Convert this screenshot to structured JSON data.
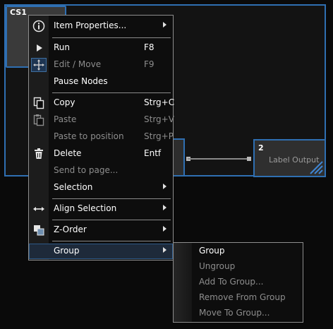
{
  "canvas": {
    "node_cs1_id": "CS1",
    "node_label_output_id": "2",
    "node_label_output_title": "Label Output"
  },
  "context_menu": {
    "items": [
      {
        "label": "Item Properties...",
        "shortcut": "",
        "icon": "info-icon",
        "submenu": true,
        "enabled": true
      },
      {
        "label": "Run",
        "shortcut": "F8",
        "icon": "play-icon",
        "submenu": false,
        "enabled": true
      },
      {
        "label": "Edit / Move",
        "shortcut": "F9",
        "icon": "move-icon",
        "submenu": false,
        "enabled": false
      },
      {
        "label": "Pause Nodes",
        "shortcut": "",
        "icon": "",
        "submenu": false,
        "enabled": true
      },
      {
        "label": "Copy",
        "shortcut": "Strg+C",
        "icon": "copy-icon",
        "submenu": false,
        "enabled": true
      },
      {
        "label": "Paste",
        "shortcut": "Strg+V",
        "icon": "paste-icon",
        "submenu": false,
        "enabled": false
      },
      {
        "label": "Paste to position",
        "shortcut": "Strg+P",
        "icon": "",
        "submenu": false,
        "enabled": false
      },
      {
        "label": "Delete",
        "shortcut": "Entf",
        "icon": "trash-icon",
        "submenu": false,
        "enabled": true
      },
      {
        "label": "Send to page...",
        "shortcut": "",
        "icon": "",
        "submenu": false,
        "enabled": false
      },
      {
        "label": "Selection",
        "shortcut": "",
        "icon": "",
        "submenu": true,
        "enabled": true
      },
      {
        "label": "Align Selection",
        "shortcut": "",
        "icon": "align-horizontal-icon",
        "submenu": true,
        "enabled": true
      },
      {
        "label": "Z-Order",
        "shortcut": "",
        "icon": "z-order-icon",
        "submenu": true,
        "enabled": true
      },
      {
        "label": "Group",
        "shortcut": "",
        "icon": "",
        "submenu": true,
        "enabled": true,
        "highlighted": true
      }
    ]
  },
  "group_submenu": {
    "items": [
      {
        "label": "Group",
        "enabled": true
      },
      {
        "label": "Ungroup",
        "enabled": false
      },
      {
        "label": "Add To Group...",
        "enabled": false
      },
      {
        "label": "Remove From Group",
        "enabled": false
      },
      {
        "label": "Move To Group...",
        "enabled": false
      }
    ]
  },
  "colors": {
    "selection_border": "#2f6fb2",
    "menu_background": "#0d0d0d",
    "disabled_text": "#8d8d8d",
    "highlight_background": "#1e2a3a"
  }
}
